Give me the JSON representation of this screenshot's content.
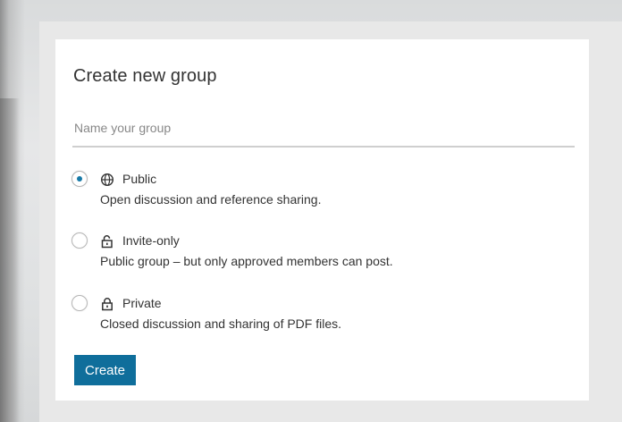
{
  "dialog": {
    "title": "Create new group",
    "name_input": {
      "placeholder": "Name your group",
      "value": ""
    },
    "options": [
      {
        "label": "Public",
        "description": "Open discussion and reference sharing.",
        "icon": "globe-icon",
        "selected": true
      },
      {
        "label": "Invite-only",
        "description": "Public group – but only approved members can post.",
        "icon": "unlocked-padlock-icon",
        "selected": false
      },
      {
        "label": "Private",
        "description": "Closed discussion and sharing of PDF files.",
        "icon": "locked-padlock-icon",
        "selected": false
      }
    ],
    "create_button_label": "Create"
  },
  "colors": {
    "accent": "#1679a7",
    "button_bg": "#0f6e9b",
    "text": "#333333",
    "placeholder": "#888888",
    "frame": "#e8e8e8"
  }
}
